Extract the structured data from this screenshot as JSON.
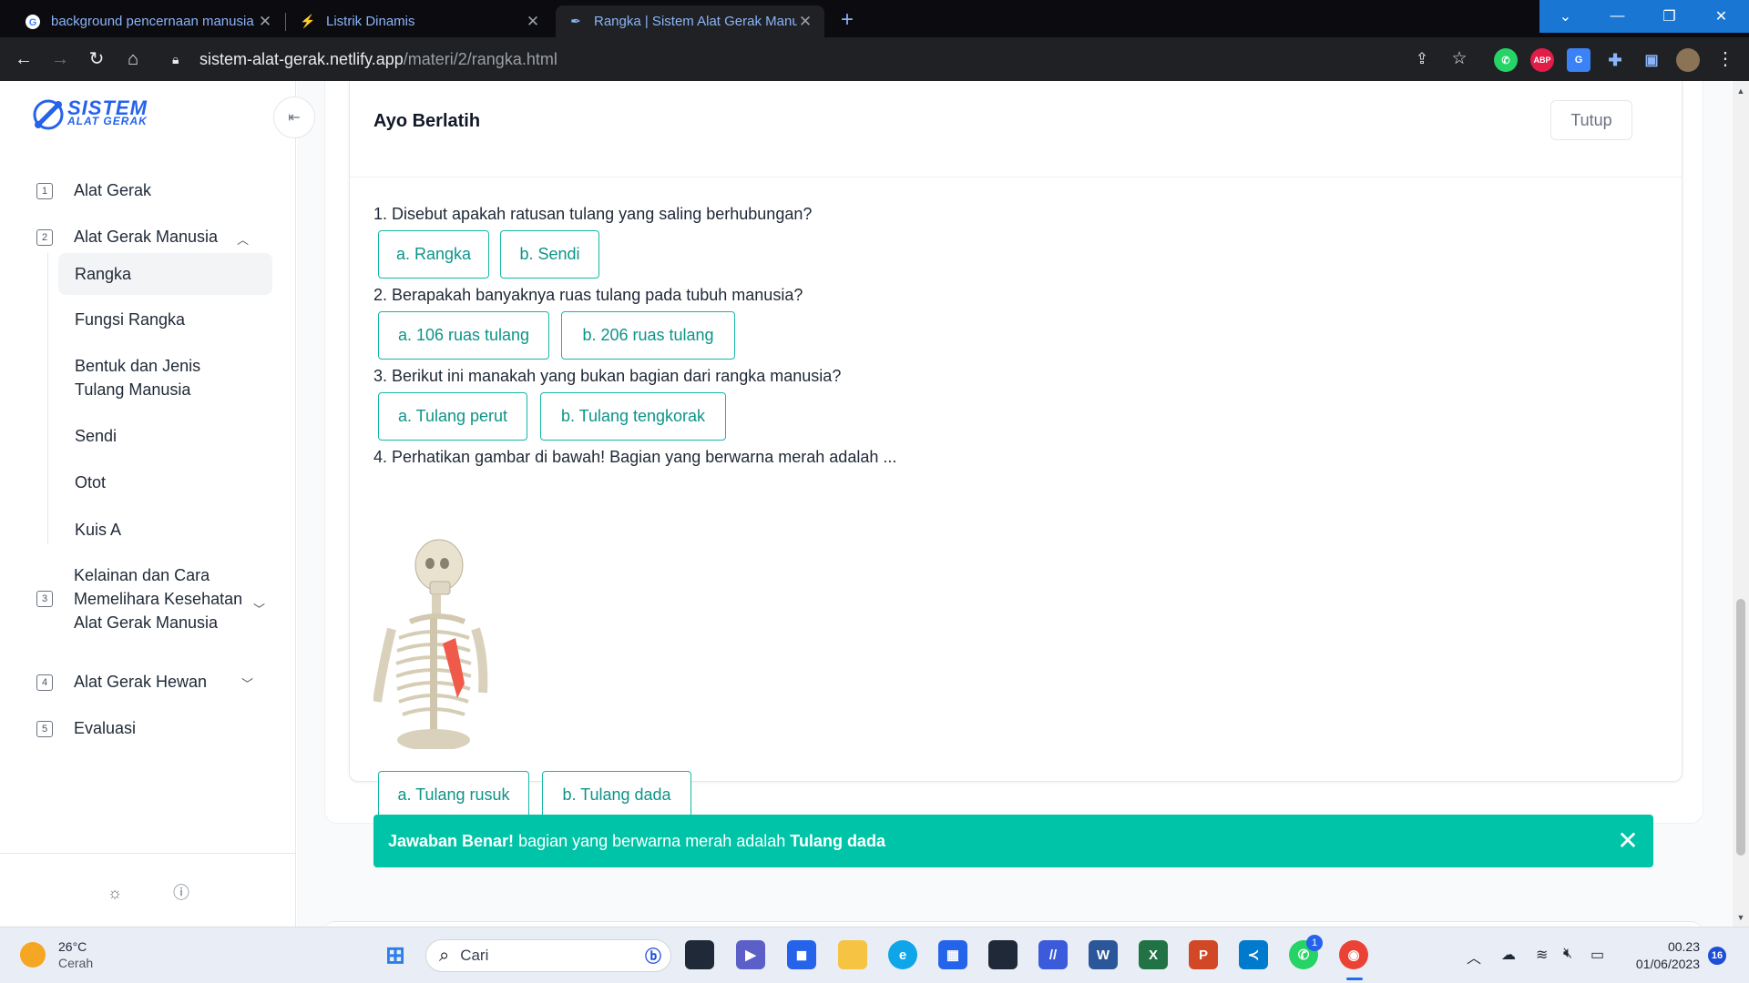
{
  "browser": {
    "tabs": [
      {
        "title": "background pencernaan manusia",
        "icon": "google-icon"
      },
      {
        "title": "Listrik Dinamis",
        "icon": "bolt-icon"
      },
      {
        "title": "Rangka | Sistem Alat Gerak Manu",
        "icon": "site-icon"
      }
    ],
    "url_host": "sistem-alat-gerak.netlify.app",
    "url_path": "/materi/2/rangka.html"
  },
  "logo": {
    "line1": "SISTEM",
    "line2": "ALAT GERAK"
  },
  "sidebar": {
    "items": [
      {
        "num": "1",
        "label": "Alat Gerak"
      },
      {
        "num": "2",
        "label": "Alat Gerak Manusia"
      },
      {
        "num": "3",
        "label": "Kelainan dan Cara Memelihara Kesehatan Alat Gerak Manusia"
      },
      {
        "num": "4",
        "label": "Alat Gerak Hewan"
      },
      {
        "num": "5",
        "label": "Evaluasi"
      }
    ],
    "subitems": [
      "Rangka",
      "Fungsi Rangka",
      "Bentuk dan Jenis Tulang Manusia",
      "Sendi",
      "Otot",
      "Kuis A"
    ],
    "item3_lines": [
      "Kelainan dan Cara",
      "Memelihara Kesehatan",
      "Alat Gerak Manusia"
    ],
    "sub3_lines": [
      "Bentuk dan Jenis",
      "Tulang Manusia"
    ]
  },
  "quiz": {
    "title": "Ayo Berlatih",
    "close_label": "Tutup",
    "questions": [
      {
        "text": "1. Disebut apakah ratusan tulang yang saling berhubungan?",
        "options": [
          "a. Rangka",
          "b. Sendi"
        ]
      },
      {
        "text": "2. Berapakah banyaknya ruas tulang pada tubuh manusia?",
        "options": [
          "a. 106 ruas tulang",
          "b. 206 ruas tulang"
        ]
      },
      {
        "text": "3. Berikut ini manakah yang bukan bagian dari rangka manusia?",
        "options": [
          "a. Tulang perut",
          "b. Tulang tengkorak"
        ]
      },
      {
        "text": "4. Perhatikan gambar di bawah! Bagian yang berwarna merah adalah ...",
        "options": [
          "a. Tulang rusuk",
          "b. Tulang dada"
        ]
      }
    ],
    "feedback": {
      "strong": "Jawaban Benar!",
      "text": " bagian yang berwarna merah adalah ",
      "answer": "Tulang dada"
    }
  },
  "taskbar": {
    "temperature": "26°C",
    "weather": "Cerah",
    "search_placeholder": "Cari",
    "time": "00.23",
    "date": "01/06/2023",
    "notifications": "16",
    "whatsapp_badge": "1"
  },
  "colors": {
    "accent": "#0d9488",
    "success": "#00c4a7",
    "brand": "#2563eb"
  }
}
